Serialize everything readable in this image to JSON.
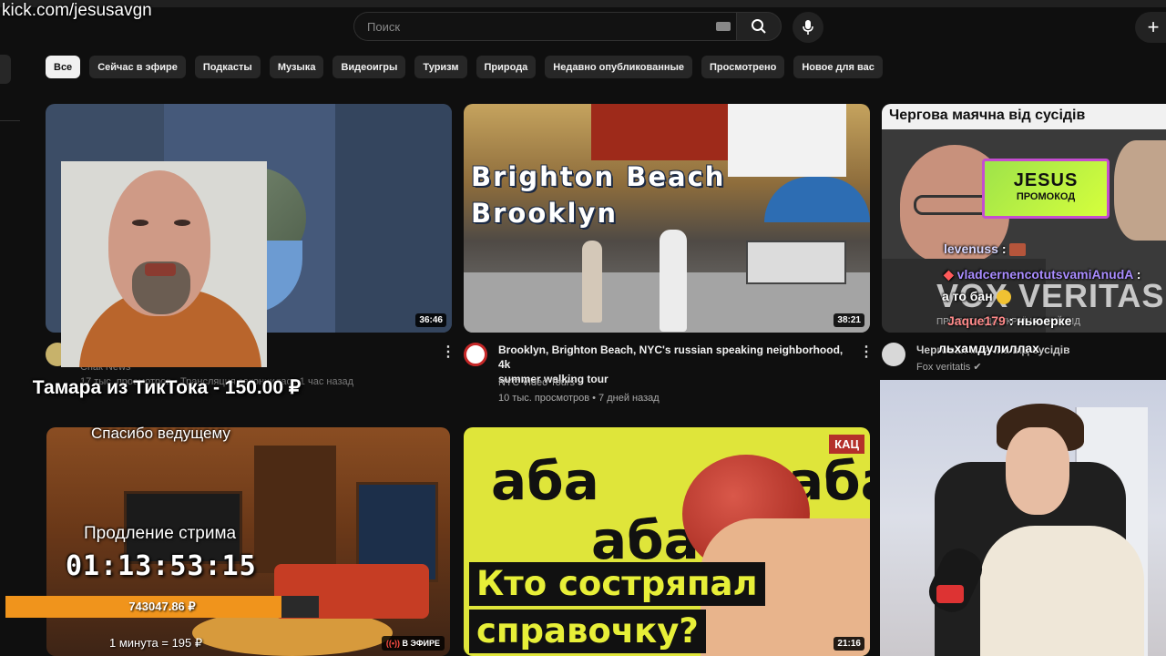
{
  "watermark": "kick.com/jesusavgn",
  "search": {
    "placeholder": "Поиск"
  },
  "chips": [
    "Все",
    "Сейчас в эфире",
    "Подкасты",
    "Музыка",
    "Видеоигры",
    "Туризм",
    "Природа",
    "Недавно опубликованные",
    "Просмотрено",
    "Новое для вас"
  ],
  "videos": [
    {
      "duration": "36:46",
      "channel": "Спак News",
      "meta": "17 тыс. просмотров • Трансляция закончилась 1 час назад"
    },
    {
      "duration": "38:21",
      "title_line1": "Brooklyn, Brighton Beach, NYC's russian speaking neighborhood, 4k",
      "title_line2": "summer walking tour",
      "channel": "NYC Video Tours",
      "meta": "10 тыс. просмотров • 7 дней назад",
      "overlay_line1": "Brighton Beach",
      "overlay_line2": "Brooklyn"
    },
    {
      "banner": "Чергова маячна від сусідів",
      "promo_big": "JESUS",
      "promo_small": "ПРОМОКОД",
      "title": "Черговая маячна від сусідів",
      "channel": "Fox veritatis",
      "watermark_text": "VOX VERITAS",
      "watermark_sub": "ПРОПАГАНДА УКРАЇНСЬКИЙ ВІД"
    },
    {
      "live_label": "В ЭФИРЕ"
    },
    {
      "duration": "21:16",
      "badge": "КАЦ",
      "headline_line1": "Кто состряпал",
      "headline_line2": "справочку?",
      "brand": "аба"
    }
  ],
  "chat": [
    {
      "user": "levenuss",
      "text": ":"
    },
    {
      "user": "vladcernencotutsvamiAnudA",
      "text": ":"
    },
    {
      "user": "",
      "text": "а то бан"
    },
    {
      "user": "Jaque179",
      "text": ": ньюерке"
    },
    {
      "user": "",
      "text": "льхамдулиллах"
    }
  ],
  "donation": {
    "message": "Тамара из ТикТока - 150.00 ₽",
    "thanks": "Спасибо ведущему",
    "extend_label": "Продление стрима",
    "timer": "01:13:53:15",
    "amount": "743047.86 ₽",
    "progress_fraction": 0.88,
    "rate": "1 минута = 195 ₽"
  },
  "colors": {
    "accent": "#f0941c",
    "live": "#ff4e45"
  }
}
